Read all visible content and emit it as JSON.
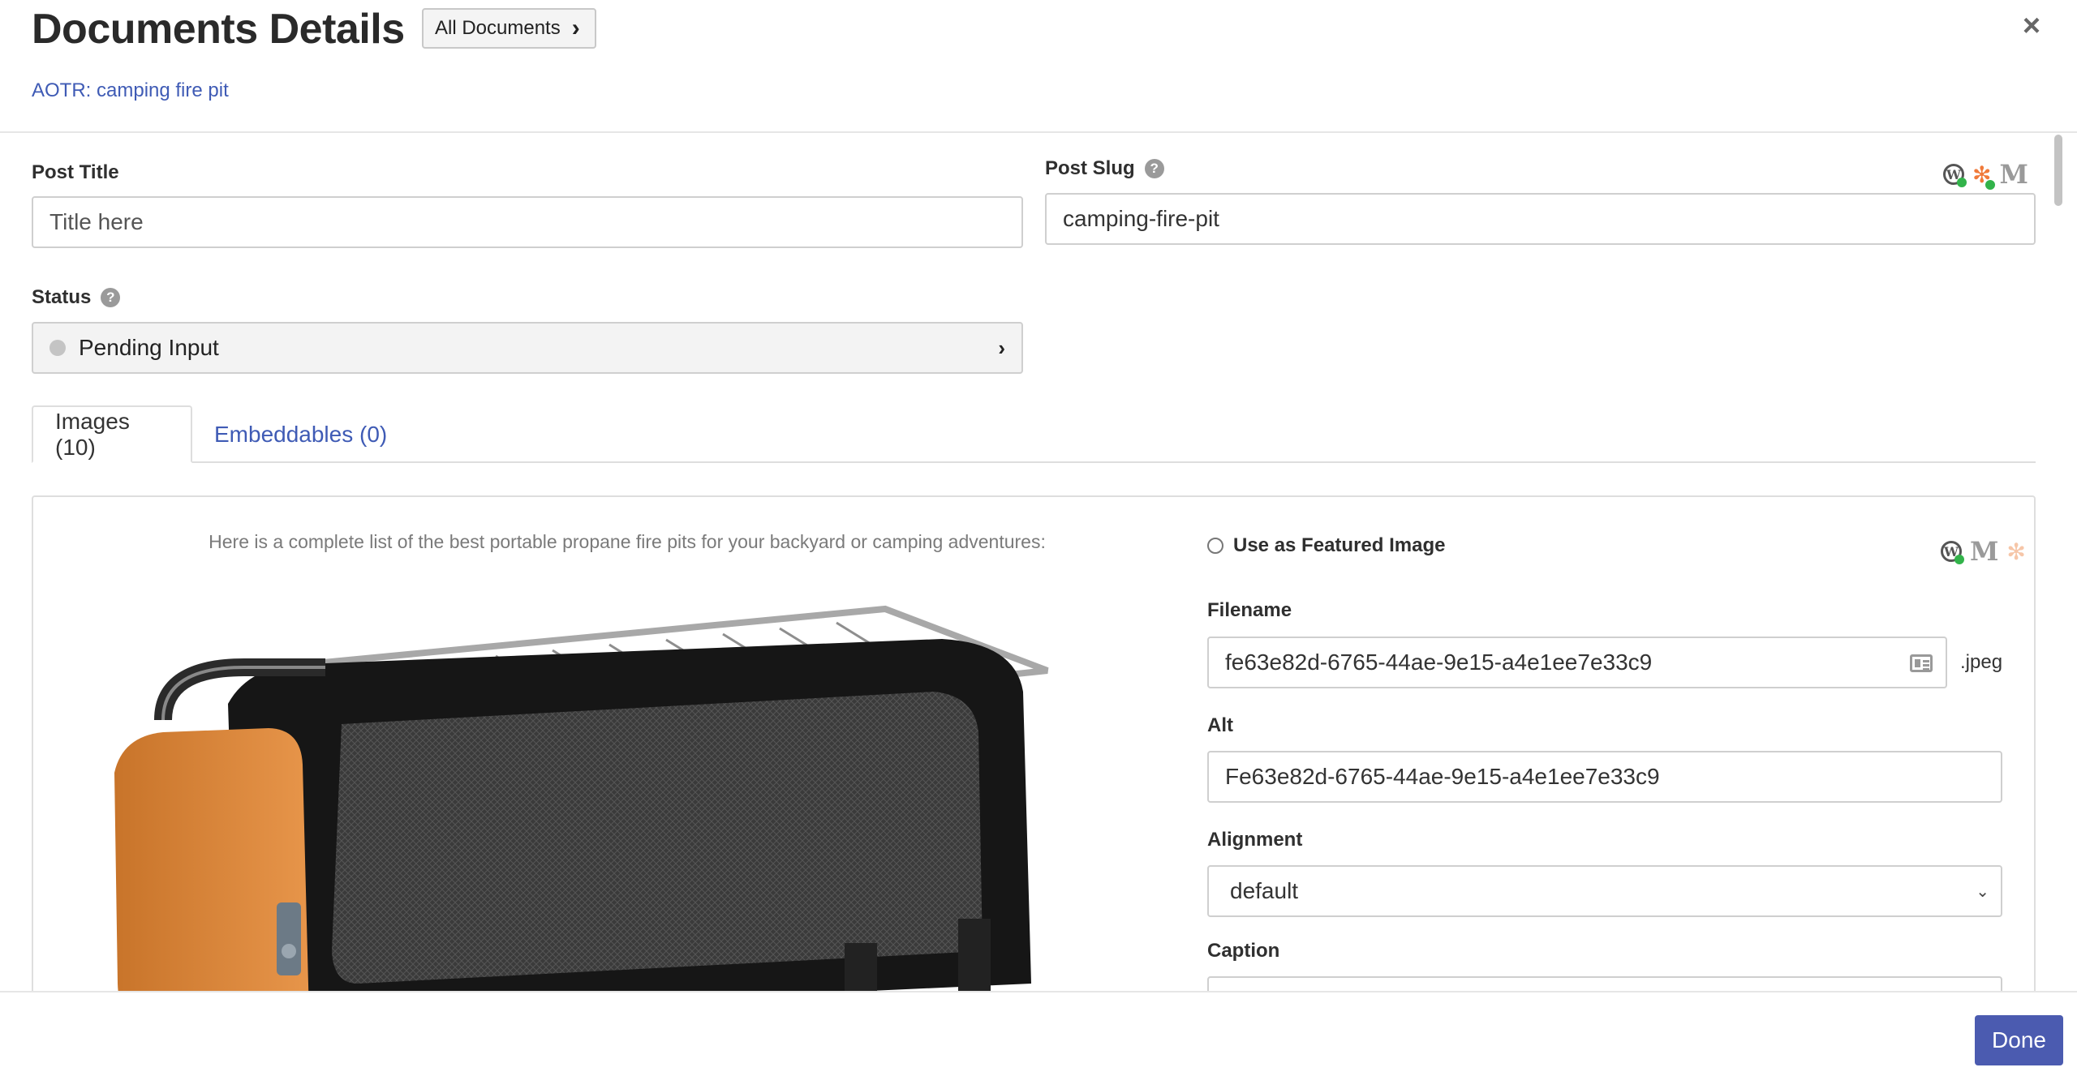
{
  "header": {
    "title": "Documents Details",
    "all_documents_label": "All Documents",
    "breadcrumb": "AOTR: camping fire pit",
    "close_label": "×"
  },
  "form": {
    "post_title_label": "Post Title",
    "post_title_placeholder": "Title here",
    "post_slug_label": "Post Slug",
    "post_slug_value": "camping-fire-pit",
    "status_label": "Status",
    "status_value": "Pending Input",
    "help_glyph": "?"
  },
  "tabs": [
    {
      "label": "Images (10)",
      "active": true
    },
    {
      "label": "Embeddables (0)",
      "active": false
    }
  ],
  "image_panel": {
    "caption": "Here is a complete list of the best portable propane fire pits for your backyard or camping adventures:",
    "featured_label": "Use as Featured Image",
    "filename_label": "Filename",
    "filename_value": "fe63e82d-6765-44ae-9e15-a4e1ee7e33c9",
    "extension": ".jpeg",
    "alt_label": "Alt",
    "alt_value": "Fe63e82d-6765-44ae-9e15-a4e1ee7e33c9",
    "alignment_label": "Alignment",
    "alignment_value": "default",
    "caption_label": "Caption"
  },
  "icons": {
    "wordpress": "W",
    "medium": "M",
    "hubspot": "✻",
    "chevron_right": "›",
    "chevron_down": "⌄"
  },
  "colors": {
    "link": "#3f5bb5",
    "done_button": "#4b5bb0",
    "status_dot": "#c4c4c4",
    "sync_green": "#32b34a",
    "hubspot_orange": "#f07a3a"
  },
  "footer": {
    "done_label": "Done"
  }
}
